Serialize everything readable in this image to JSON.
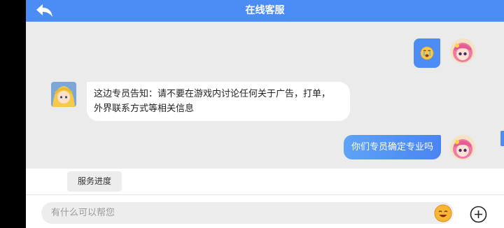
{
  "header": {
    "title": "在线客服",
    "back_icon": "back-arrow-icon",
    "color": "#4b8df5"
  },
  "messages": [
    {
      "side": "right",
      "type": "emoji",
      "emoji": "crying-face"
    },
    {
      "side": "left",
      "type": "text",
      "lines": [
        "这边专员告知：请不要在游戏内讨论任何关于广告，打单，",
        "外界联系方式等相关信息"
      ]
    },
    {
      "side": "right",
      "type": "text",
      "text": "你们专员确定专业吗"
    }
  ],
  "quick_actions": [
    {
      "label": "服务进度"
    }
  ],
  "composer": {
    "placeholder": "有什么可以帮您",
    "emoji_icon": "smiley-face-icon",
    "add_icon": "plus-circle-icon"
  }
}
